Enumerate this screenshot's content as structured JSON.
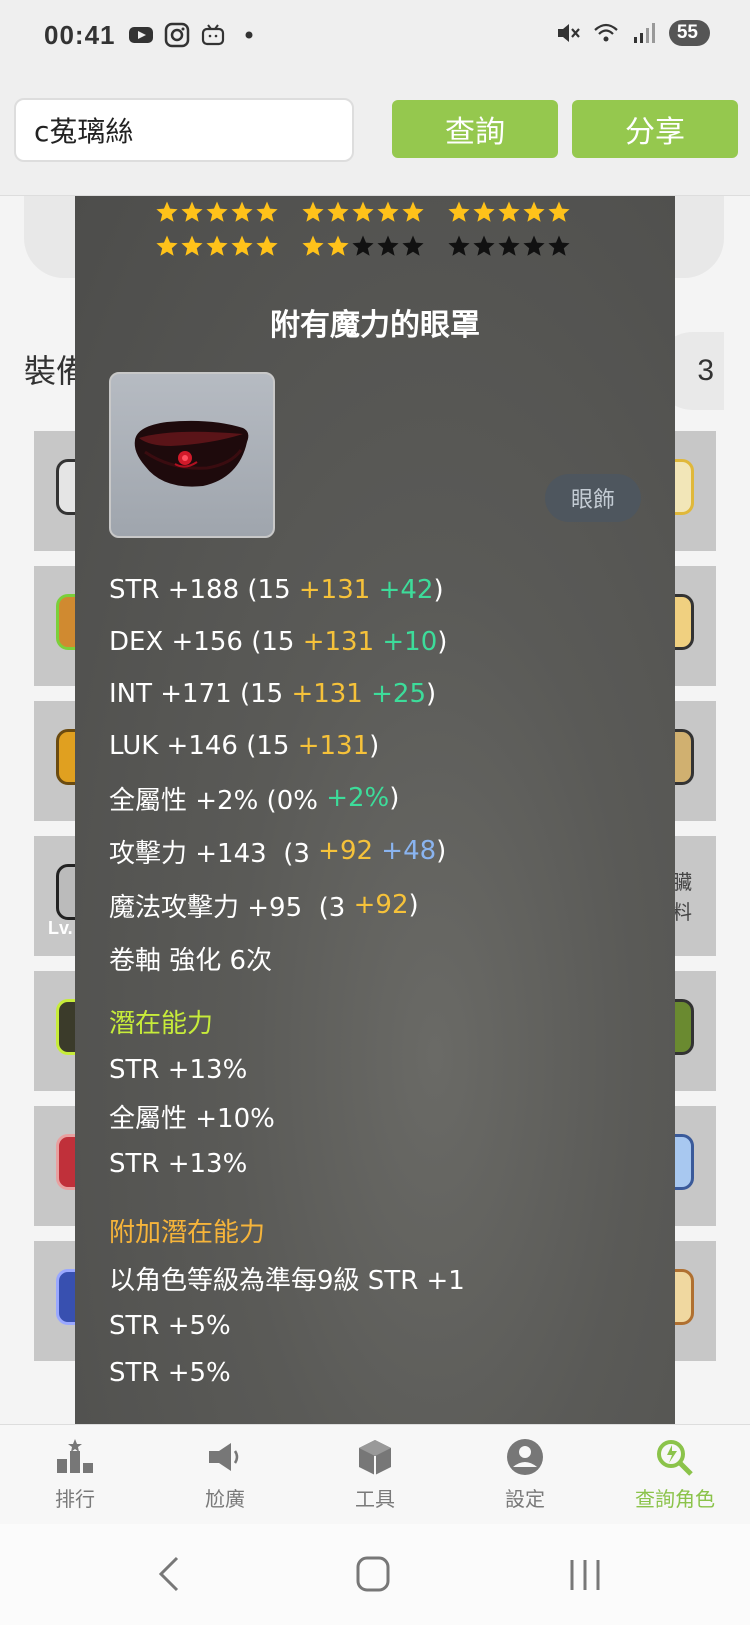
{
  "status_bar": {
    "time": "00:41",
    "battery": "55",
    "left_icons": [
      "youtube-icon",
      "instagram-icon",
      "bilibili-icon",
      "dot-icon"
    ],
    "right_icons": [
      "mute-icon",
      "wifi-icon",
      "signal-icon"
    ]
  },
  "search": {
    "value": "c菟璃絲",
    "query_label": "查詢",
    "share_label": "分享"
  },
  "background": {
    "section_title": "裝備",
    "count_label": "3",
    "side_text_1": "臟",
    "side_text_2": "料",
    "level_label": "Lv."
  },
  "tooltip": {
    "stars": {
      "row1": [
        5,
        5,
        5
      ],
      "row2": [
        5,
        2,
        0
      ],
      "max_per_group": 5
    },
    "item_name": "附有魔力的眼罩",
    "item_type": "眼飾",
    "stats": [
      {
        "base": "STR +188 (15 ",
        "plus1": "+131",
        "plus2": " +42",
        "plus2_color": "green",
        "close": ")"
      },
      {
        "base": "DEX +156 (15 ",
        "plus1": "+131",
        "plus2": " +10",
        "plus2_color": "green",
        "close": ")"
      },
      {
        "base": "INT +171 (15 ",
        "plus1": "+131",
        "plus2": " +25",
        "plus2_color": "green",
        "close": ")"
      },
      {
        "base": "LUK +146 (15 ",
        "plus1": "+131",
        "plus2": "",
        "plus2_color": "green",
        "close": ")"
      },
      {
        "base": "全屬性 +2% (0% ",
        "plus1": "",
        "plus2": "+2%",
        "plus2_color": "green",
        "close": ")"
      },
      {
        "base": "攻擊力 +143  (3 ",
        "plus1": "+92",
        "plus2": " +48",
        "plus2_color": "blue",
        "close": ")"
      },
      {
        "base": "魔法攻擊力 +95  (3 ",
        "plus1": "+92",
        "plus2": "",
        "plus2_color": "green",
        "close": ")"
      }
    ],
    "scroll_line": "卷軸 強化 6次",
    "potential_title": "潛在能力",
    "potential": [
      "STR +13%",
      "全屬性 +10%",
      "STR +13%"
    ],
    "additional_title": "附加潛在能力",
    "additional": [
      "以角色等級為準每9級 STR +1",
      "STR +5%",
      "STR +5%"
    ]
  },
  "bottom_nav": [
    {
      "label": "排行",
      "icon": "ranking-icon",
      "active": false
    },
    {
      "label": "尬廣",
      "icon": "megaphone-icon",
      "active": false
    },
    {
      "label": "工具",
      "icon": "toolbox-icon",
      "active": false
    },
    {
      "label": "設定",
      "icon": "account-icon",
      "active": false
    },
    {
      "label": "查詢角色",
      "icon": "search-character-icon",
      "active": true
    }
  ],
  "colors": {
    "accent_green": "#95c84e",
    "nav_active": "#8bc34a",
    "star_gold": "#ffc21a",
    "stat_yellow": "#f6c23a",
    "stat_green": "#3ddc9a",
    "stat_blue": "#8ab4f0",
    "potential_title": "#c7ec3a",
    "additional_title": "#f6b43a"
  }
}
